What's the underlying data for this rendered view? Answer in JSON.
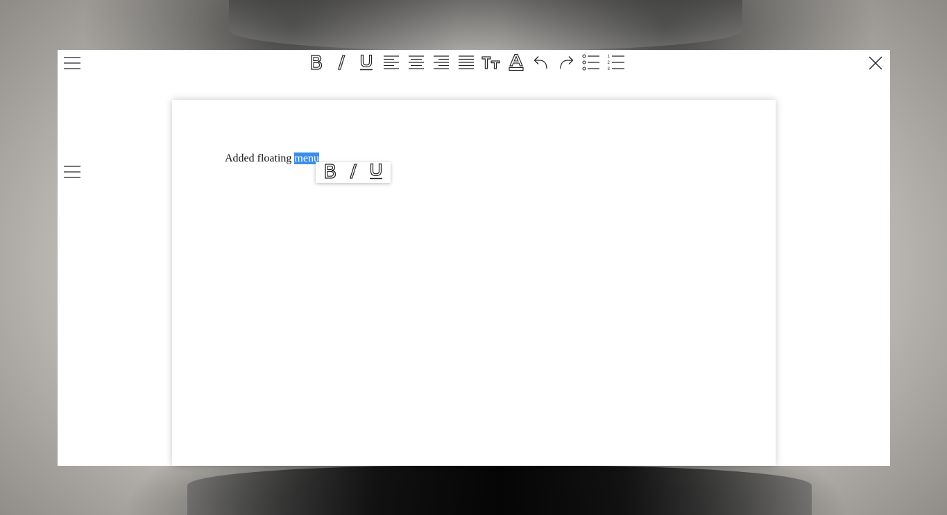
{
  "document": {
    "text_before": "Added floating ",
    "selected_text": "menu"
  },
  "toolbar": {
    "menu_icon": "hamburger-menu-icon",
    "buttons": [
      {
        "name": "bold",
        "icon": "bold-icon"
      },
      {
        "name": "italic",
        "icon": "italic-icon"
      },
      {
        "name": "underline",
        "icon": "underline-icon"
      },
      {
        "name": "align-left",
        "icon": "align-left-icon"
      },
      {
        "name": "align-center",
        "icon": "align-center-icon"
      },
      {
        "name": "align-right",
        "icon": "align-right-icon"
      },
      {
        "name": "align-justify",
        "icon": "align-justify-icon"
      },
      {
        "name": "text-size",
        "icon": "text-size-icon"
      },
      {
        "name": "text-color",
        "icon": "text-color-icon"
      },
      {
        "name": "undo",
        "icon": "undo-icon"
      },
      {
        "name": "redo",
        "icon": "redo-icon"
      },
      {
        "name": "bullet-list",
        "icon": "bullet-list-icon"
      },
      {
        "name": "numbered-list",
        "icon": "numbered-list-icon"
      }
    ],
    "close_icon": "close-icon"
  },
  "side_menu": {
    "icon": "hamburger-menu-icon"
  },
  "floating_menu": {
    "buttons": [
      {
        "name": "bold",
        "icon": "bold-icon"
      },
      {
        "name": "italic",
        "icon": "italic-icon"
      },
      {
        "name": "underline",
        "icon": "underline-icon"
      }
    ]
  },
  "colors": {
    "selection": "#3b8ee8",
    "icon_stroke": "#222222",
    "window_bg": "#ffffff"
  }
}
